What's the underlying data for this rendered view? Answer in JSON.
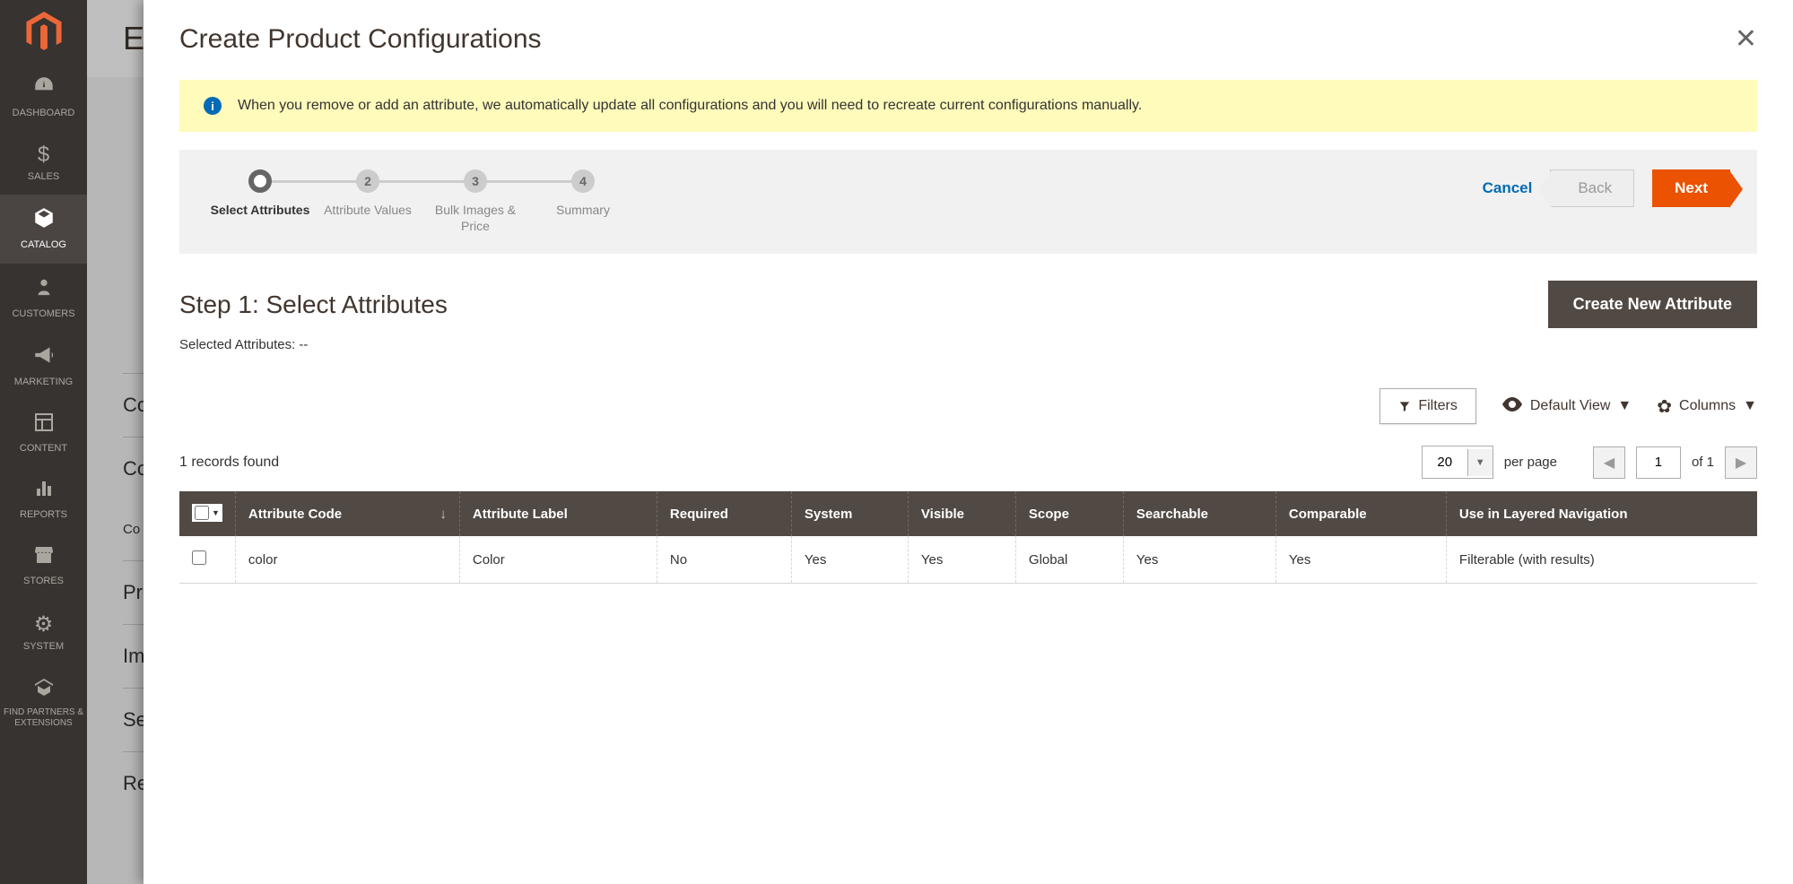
{
  "nav": [
    {
      "label": "DASHBOARD",
      "icon": "dashboard"
    },
    {
      "label": "SALES",
      "icon": "dollar"
    },
    {
      "label": "CATALOG",
      "icon": "cube",
      "active": true
    },
    {
      "label": "CUSTOMERS",
      "icon": "person"
    },
    {
      "label": "MARKETING",
      "icon": "megaphone"
    },
    {
      "label": "CONTENT",
      "icon": "layout"
    },
    {
      "label": "REPORTS",
      "icon": "bars"
    },
    {
      "label": "STORES",
      "icon": "store"
    },
    {
      "label": "SYSTEM",
      "icon": "gear"
    },
    {
      "label": "FIND PARTNERS & EXTENSIONS",
      "icon": "partners"
    }
  ],
  "backdrop": {
    "title_fragment": "EMI",
    "sections": [
      "Co",
      "Co",
      "Co col",
      "Pro",
      "Ima",
      "Sea",
      "Rel"
    ]
  },
  "modal": {
    "title": "Create Product Configurations",
    "info_message": "When you remove or add an attribute, we automatically update all configurations and you will need to recreate current configurations manually."
  },
  "stepper": {
    "steps": [
      {
        "num": "1",
        "label": "Select Attributes",
        "active": true
      },
      {
        "num": "2",
        "label": "Attribute Values"
      },
      {
        "num": "3",
        "label": "Bulk Images & Price"
      },
      {
        "num": "4",
        "label": "Summary"
      }
    ],
    "cancel": "Cancel",
    "back": "Back",
    "next": "Next"
  },
  "step_content": {
    "title": "Step 1: Select Attributes",
    "create_btn": "Create New Attribute",
    "selected_label": "Selected Attributes:",
    "selected_value": "--"
  },
  "grid_controls": {
    "filters": "Filters",
    "default_view": "Default View",
    "columns": "Columns"
  },
  "records": {
    "count_text": "1 records found",
    "page_size": "20",
    "per_page_label": "per page",
    "current_page": "1",
    "of_label": "of",
    "total_pages": "1"
  },
  "table": {
    "headers": [
      "Attribute Code",
      "Attribute Label",
      "Required",
      "System",
      "Visible",
      "Scope",
      "Searchable",
      "Comparable",
      "Use in Layered Navigation"
    ],
    "rows": [
      {
        "code": "color",
        "label": "Color",
        "required": "No",
        "system": "Yes",
        "visible": "Yes",
        "scope": "Global",
        "searchable": "Yes",
        "comparable": "Yes",
        "layered": "Filterable (with results)"
      }
    ]
  }
}
